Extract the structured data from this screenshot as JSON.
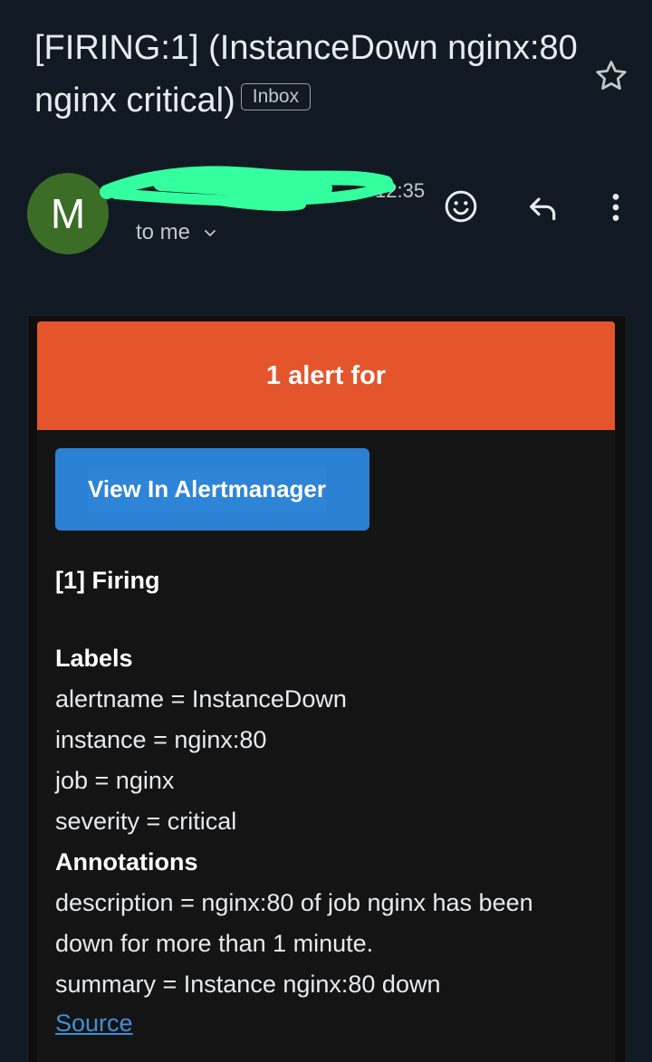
{
  "email": {
    "subject": "[FIRING:1]  (InstanceDown nginx:80 nginx critical)",
    "folder_chip": "Inbox",
    "sender_initial": "M",
    "time": "12:35",
    "recipient": "to me"
  },
  "icons": {
    "star": "star-icon",
    "emoji": "emoji-icon",
    "reply": "reply-icon",
    "more": "more-vert-icon",
    "expand": "chevron-down-icon"
  },
  "colors": {
    "background": "#111a22",
    "avatar": "#3b6d26",
    "alert_banner": "#e4552c",
    "button": "#2a80d3",
    "link": "#3f8fd6",
    "redaction": "#33ff9e"
  },
  "body": {
    "banner_text": "1 alert for",
    "button_label": "View In Alertmanager",
    "firing_heading": "[1] Firing",
    "labels_title": "Labels",
    "labels": [
      "alertname = InstanceDown",
      "instance = nginx:80",
      "job = nginx",
      "severity = critical"
    ],
    "annotations_title": "Annotations",
    "annotations": [
      "description = nginx:80 of job nginx has been",
      "down for more than 1 minute.",
      "summary = Instance nginx:80 down"
    ],
    "source_link": "Source"
  }
}
